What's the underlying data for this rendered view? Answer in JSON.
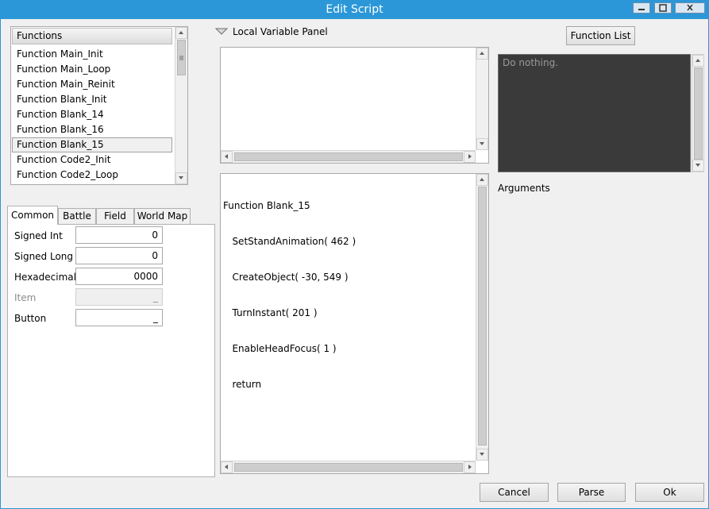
{
  "window": {
    "title": "Edit Script"
  },
  "functions_list": {
    "header": "Functions",
    "items": [
      "Function Main_Init",
      "Function Main_Loop",
      "Function Main_Reinit",
      "Function Blank_Init",
      "Function Blank_14",
      "Function Blank_16",
      "Function Blank_15",
      "Function Code2_Init",
      "Function Code2_Loop"
    ],
    "selected": "Function Blank_15"
  },
  "tabs": [
    "Common",
    "Battle",
    "Field",
    "World Map"
  ],
  "active_tab": "Common",
  "fields": {
    "signed_int": {
      "label": "Signed Int",
      "value": "0"
    },
    "signed_long": {
      "label": "Signed Long",
      "value": "0"
    },
    "hexadecimal": {
      "label": "Hexadecimal",
      "value": "0000"
    },
    "item": {
      "label": "Item",
      "value": "_"
    },
    "button": {
      "label": "Button",
      "value": "_"
    }
  },
  "local_variable_panel": {
    "label": "Local Variable Panel"
  },
  "script": {
    "lines": [
      "Function Blank_15",
      "   SetStandAnimation( 462 )",
      "   CreateObject( -30, 549 )",
      "   TurnInstant( 201 )",
      "   EnableHeadFocus( 1 )",
      "   return"
    ]
  },
  "function_list_button": "Function List",
  "description": "Do nothing.",
  "arguments_label": "Arguments",
  "buttons": {
    "cancel": "Cancel",
    "parse": "Parse",
    "ok": "Ok"
  },
  "icons": {
    "minimize": "minimize-icon",
    "maximize": "maximize-icon",
    "close": "close-icon",
    "collapse": "triangle-down-icon"
  },
  "colors": {
    "titlebar": "#2b97d8",
    "description_bg": "#3a3a3a"
  }
}
